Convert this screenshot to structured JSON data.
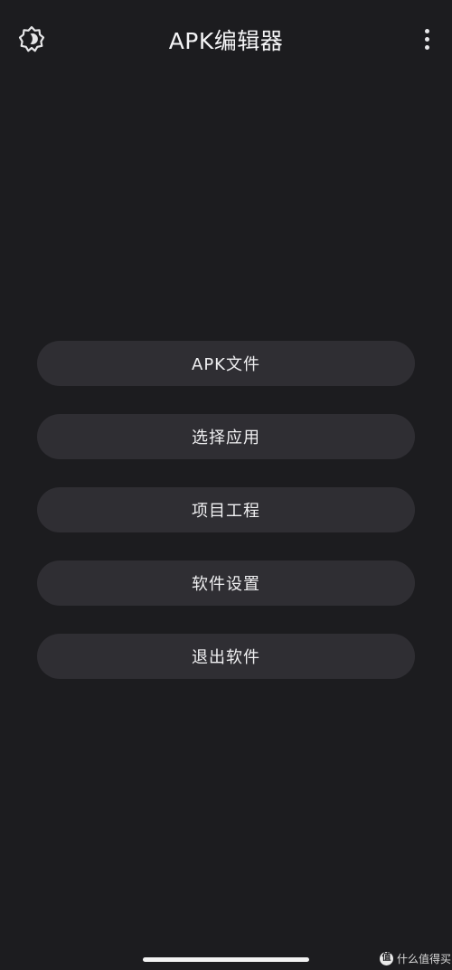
{
  "app": {
    "title": "APK编辑器"
  },
  "header": {
    "theme_icon": "brightness-theme-icon",
    "more_icon": "more-vert-icon"
  },
  "menu": {
    "items": [
      {
        "label": "APK文件"
      },
      {
        "label": "选择应用"
      },
      {
        "label": "项目工程"
      },
      {
        "label": "软件设置"
      },
      {
        "label": "退出软件"
      }
    ]
  },
  "watermark": {
    "logo_glyph": "值",
    "text": "什么值得买"
  },
  "colors": {
    "background": "#1c1c1f",
    "button": "#2f2e33",
    "text": "#f0f0f2"
  }
}
